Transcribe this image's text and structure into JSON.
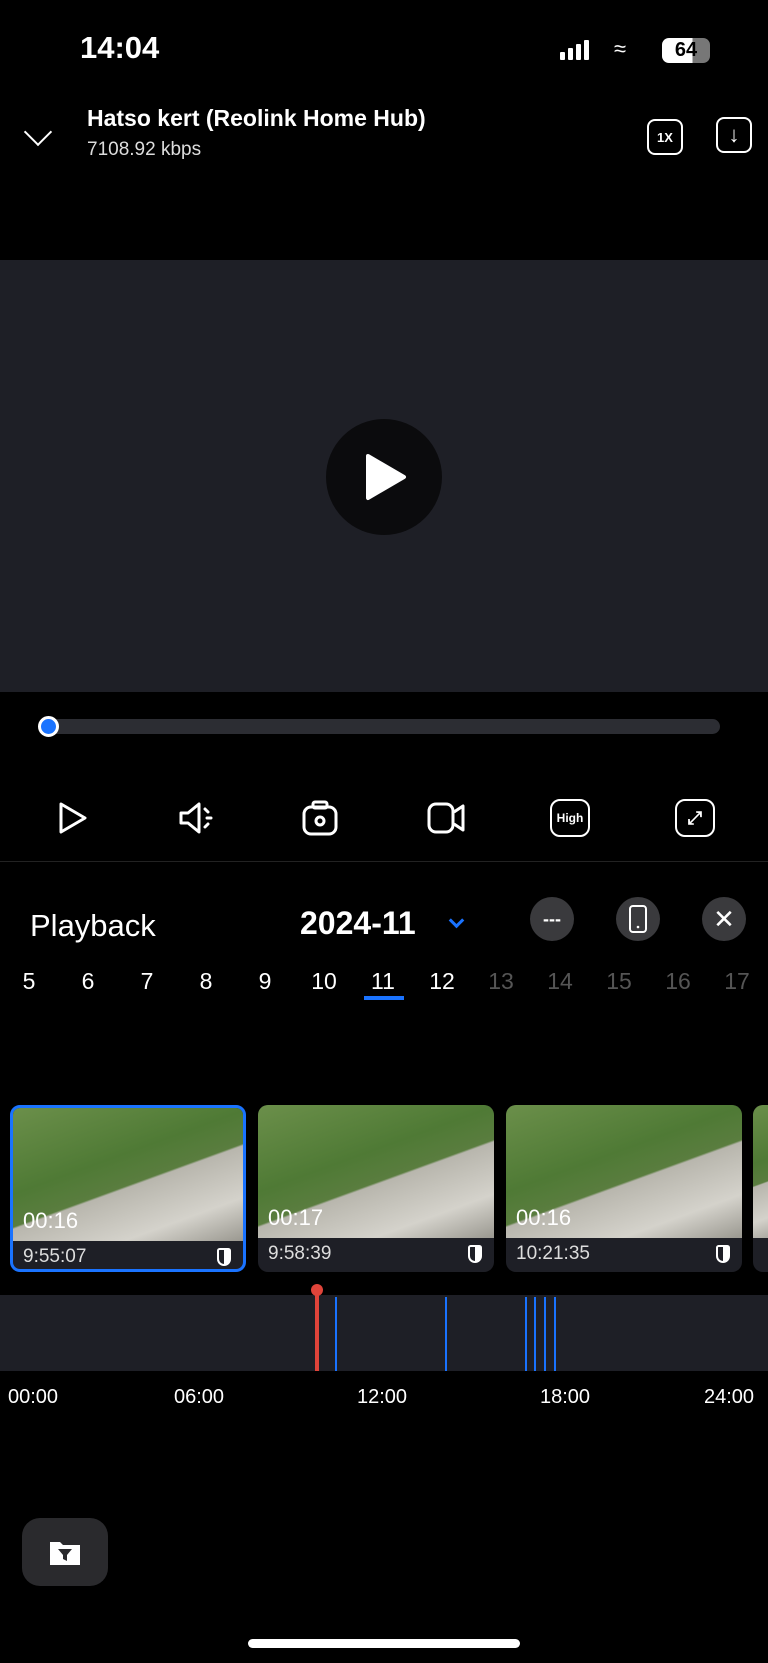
{
  "status": {
    "time": "14:04",
    "battery": "64"
  },
  "header": {
    "title": "Hatso kert (Reolink Home Hub)",
    "bitrate": "7108.92 kbps",
    "speed_label": "1X"
  },
  "player": {
    "progress": 0
  },
  "controls": {
    "quality_label": "High"
  },
  "playback": {
    "title": "Playback",
    "month": "2024-11",
    "more_label": "---",
    "selected_day": "11",
    "days": [
      {
        "d": "5",
        "on": true
      },
      {
        "d": "6",
        "on": true
      },
      {
        "d": "7",
        "on": true
      },
      {
        "d": "8",
        "on": true
      },
      {
        "d": "9",
        "on": true
      },
      {
        "d": "10",
        "on": true
      },
      {
        "d": "11",
        "on": true
      },
      {
        "d": "12",
        "on": true
      },
      {
        "d": "13",
        "on": false
      },
      {
        "d": "14",
        "on": false
      },
      {
        "d": "15",
        "on": false
      },
      {
        "d": "16",
        "on": false
      },
      {
        "d": "17",
        "on": false
      }
    ]
  },
  "clips": [
    {
      "duration": "00:16",
      "time": "9:55:07"
    },
    {
      "duration": "00:17",
      "time": "9:58:39"
    },
    {
      "duration": "00:16",
      "time": "10:21:35"
    }
  ],
  "timeline": {
    "ticks": [
      "00:00",
      "06:00",
      "12:00",
      "18:00",
      "24:00"
    ],
    "cursor_hour": 9.92,
    "events_hours": [
      10.47,
      13.9,
      16.4,
      16.7,
      17.0,
      17.3
    ],
    "event_color": "#1a73ff",
    "cursor_color": "#e0443a"
  }
}
